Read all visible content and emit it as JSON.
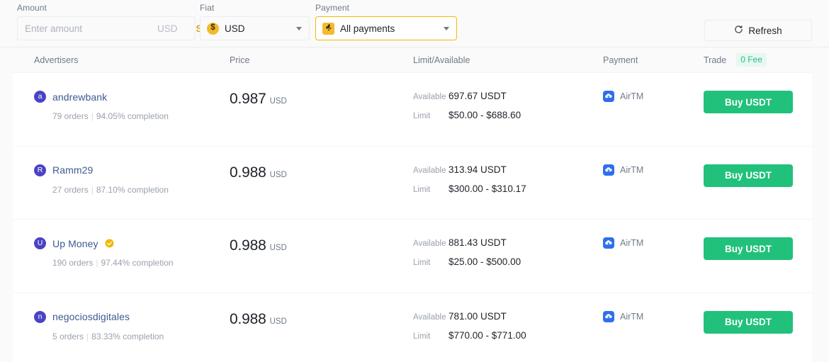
{
  "filters": {
    "amount": {
      "label": "Amount",
      "placeholder": "Enter amount",
      "value": "",
      "currency": "USD",
      "search_label": "Search"
    },
    "fiat": {
      "label": "Fiat",
      "selected": "USD",
      "icon": "usd-coin-icon"
    },
    "payment": {
      "label": "Payment",
      "selected": "All payments",
      "icon": "binance-diamond-icon"
    },
    "refresh": {
      "label": "Refresh",
      "icon": "refresh-icon"
    }
  },
  "table": {
    "columns": {
      "advertisers": "Advertisers",
      "price": "Price",
      "limit_available": "Limit/Available",
      "payment": "Payment",
      "trade": "Trade",
      "fee_badge": "0 Fee"
    },
    "labels": {
      "available": "Available",
      "limit": "Limit",
      "orders_separator": "|"
    },
    "rows": [
      {
        "avatar_letter": "a",
        "name": "andrewbank",
        "verified": false,
        "orders": "79 orders",
        "completion": "94.05% completion",
        "price": "0.987",
        "price_currency": "USD",
        "available": "697.67 USDT",
        "limit": "$50.00 - $688.60",
        "payment_method": "AirTM",
        "action": "Buy USDT"
      },
      {
        "avatar_letter": "R",
        "name": "Ramm29",
        "verified": false,
        "orders": "27 orders",
        "completion": "87.10% completion",
        "price": "0.988",
        "price_currency": "USD",
        "available": "313.94 USDT",
        "limit": "$300.00 - $310.17",
        "payment_method": "AirTM",
        "action": "Buy USDT"
      },
      {
        "avatar_letter": "U",
        "name": "Up Money",
        "verified": true,
        "orders": "190 orders",
        "completion": "97.44% completion",
        "price": "0.988",
        "price_currency": "USD",
        "available": "881.43 USDT",
        "limit": "$25.00 - $500.00",
        "payment_method": "AirTM",
        "action": "Buy USDT"
      },
      {
        "avatar_letter": "n",
        "name": "negociosdigitales",
        "verified": false,
        "orders": "5 orders",
        "completion": "83.33% completion",
        "price": "0.988",
        "price_currency": "USD",
        "available": "781.00 USDT",
        "limit": "$770.00 - $771.00",
        "payment_method": "AirTM",
        "action": "Buy USDT"
      }
    ]
  },
  "colors": {
    "accent_yellow": "#f0b90b",
    "buy_green": "#21c17c",
    "fee_green": "#26c281",
    "link_blue": "#3d5a91",
    "avatar_purple": "#4a43c4",
    "airtm_blue": "#2f6fed"
  }
}
